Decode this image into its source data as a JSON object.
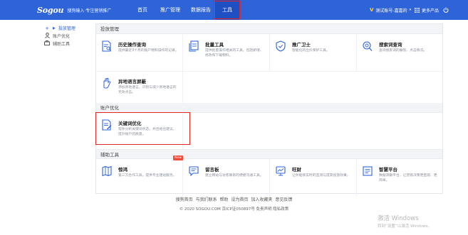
{
  "brand": {
    "logo": "Sogou",
    "slogan": "搜狗输入·专注营销推广"
  },
  "nav": [
    {
      "label": "首页"
    },
    {
      "label": "推广管理"
    },
    {
      "label": "数据报告"
    },
    {
      "label": "工具"
    }
  ],
  "topright": {
    "account": "测试账号-嘉嘉的",
    "more_products": "更多产品"
  },
  "sidebar": [
    {
      "label": "投放管理"
    },
    {
      "label": "账户优化"
    },
    {
      "label": "辅助工具"
    }
  ],
  "sections": [
    {
      "title": "投放管理",
      "cards": [
        {
          "title": "历史操作查询",
          "desc": "提供最近3个月的账户物料操作的记录。"
        },
        {
          "title": "批量工具",
          "desc": "提供批量操作相关的工具，包括新增、修改和下载物料。"
        },
        {
          "title": "推广卫士",
          "desc": "智能化的出价保护工具。"
        },
        {
          "title": "搜索词查询",
          "desc": "查询搜索词的展现、点击情况。"
        },
        {
          "title": "异地语言屏蔽",
          "desc": "添加异地语言，识别与减少异地语言的无效点击。"
        }
      ]
    },
    {
      "title": "账户优化",
      "cards": [
        {
          "title": "关键词优化",
          "desc": "帮你分析关键词状态，并且给出建议，提升账户的质量。"
        }
      ]
    },
    {
      "title": "辅助工具",
      "cards": [
        {
          "title": "惊鸿",
          "desc": "第三方合作工具，提供专业建站服务。",
          "badge": "New"
        },
        {
          "title": "留言板",
          "desc": "建立网站与访客联系的便捷沟通工具。"
        },
        {
          "title": "旺财",
          "desc": "让你能够实时的监测与提高投放效果。"
        },
        {
          "title": "智慧平台",
          "desc": "数据洞察平台，让营销决策更直观、更简单。"
        }
      ]
    }
  ],
  "footer": {
    "links": [
      "搜狗首页",
      "与我们联系",
      "帮助",
      "设为首页",
      "加入收藏夹",
      "意见反馈"
    ],
    "copyright": "© 2020 SOGOU.COM 京ICP证050897号 免责声明 隐私政策"
  },
  "watermark": {
    "line1": "激活 Windows",
    "line2": "转到“设置”以激活 Windows。"
  },
  "colors": {
    "topbar": "#2f64d9",
    "accent": "#2f64d9",
    "highlight": "#e02424"
  }
}
